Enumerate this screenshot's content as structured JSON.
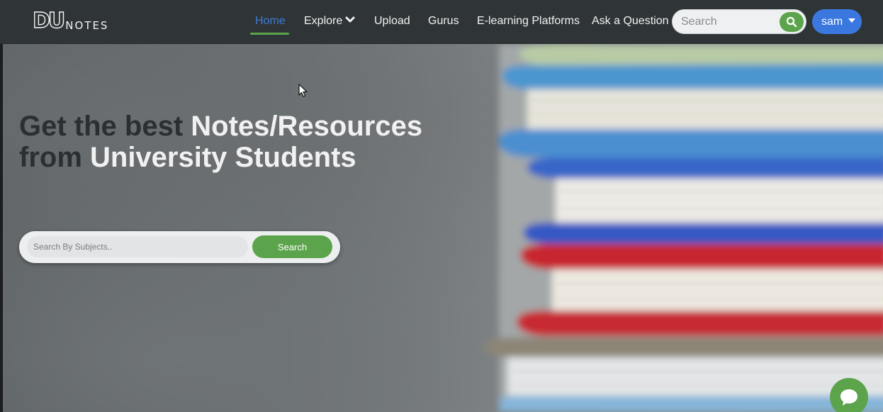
{
  "brand": {
    "logo_du": "DU",
    "logo_notes": "NOTES"
  },
  "nav": {
    "items": [
      {
        "label": "Home",
        "active": true
      },
      {
        "label": "Explore"
      },
      {
        "label": "Upload"
      },
      {
        "label": "Gurus"
      },
      {
        "label": "E-learning Platforms"
      },
      {
        "label": "Ask a Question"
      }
    ],
    "search_placeholder": "Search",
    "user_label": "sam"
  },
  "hero": {
    "headline_line1_dark": "Get the best ",
    "headline_line1_light": "Notes/Resources",
    "headline_line2_dark": "from ",
    "headline_line2_light": "University Students",
    "search_placeholder": "Search By Subjects..",
    "search_button": "Search"
  },
  "colors": {
    "accent_green": "#5ba44b",
    "accent_blue": "#3a78e0",
    "active_link": "#3f7bd6",
    "navbar_bg": "#2f3437"
  },
  "icons": {
    "nav_search": "search-icon",
    "explore_dropdown": "chevron-down-icon",
    "user_menu": "caret-down-icon",
    "chat": "chat-bubble-icon"
  }
}
